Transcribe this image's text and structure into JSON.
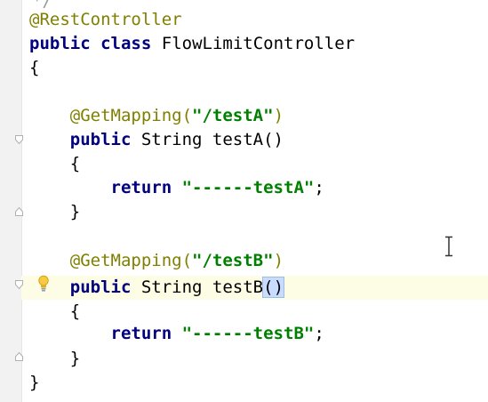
{
  "editor": {
    "top_fragment": "*/",
    "annotation_class": "@RestController",
    "kw_public": "public",
    "kw_class": "class",
    "class_name": "FlowLimitController",
    "open_brace": "{",
    "close_brace": "}",
    "method_a": {
      "annotation": "@GetMapping(",
      "path": "\"/testA\"",
      "annotation_close": ")",
      "kw_public": "public",
      "signature": " String testA()",
      "kw_return": "return",
      "return_value": "\"------testA\"",
      "semicolon": ";"
    },
    "method_b": {
      "annotation": "@GetMapping(",
      "path": "\"/testB\"",
      "annotation_close": ")",
      "kw_public": "public",
      "signature": " String testB",
      "parens": "()",
      "kw_return": "return",
      "return_value": "\"------testB\"",
      "semicolon": ";"
    }
  },
  "icons": {
    "fold": "fold-marker-icon",
    "bulb": "lightbulb-icon",
    "cursor": "text-cursor-icon"
  },
  "colors": {
    "annotation": "#808000",
    "keyword": "#000080",
    "string": "#008000",
    "caret_line": "#fdfce4"
  }
}
